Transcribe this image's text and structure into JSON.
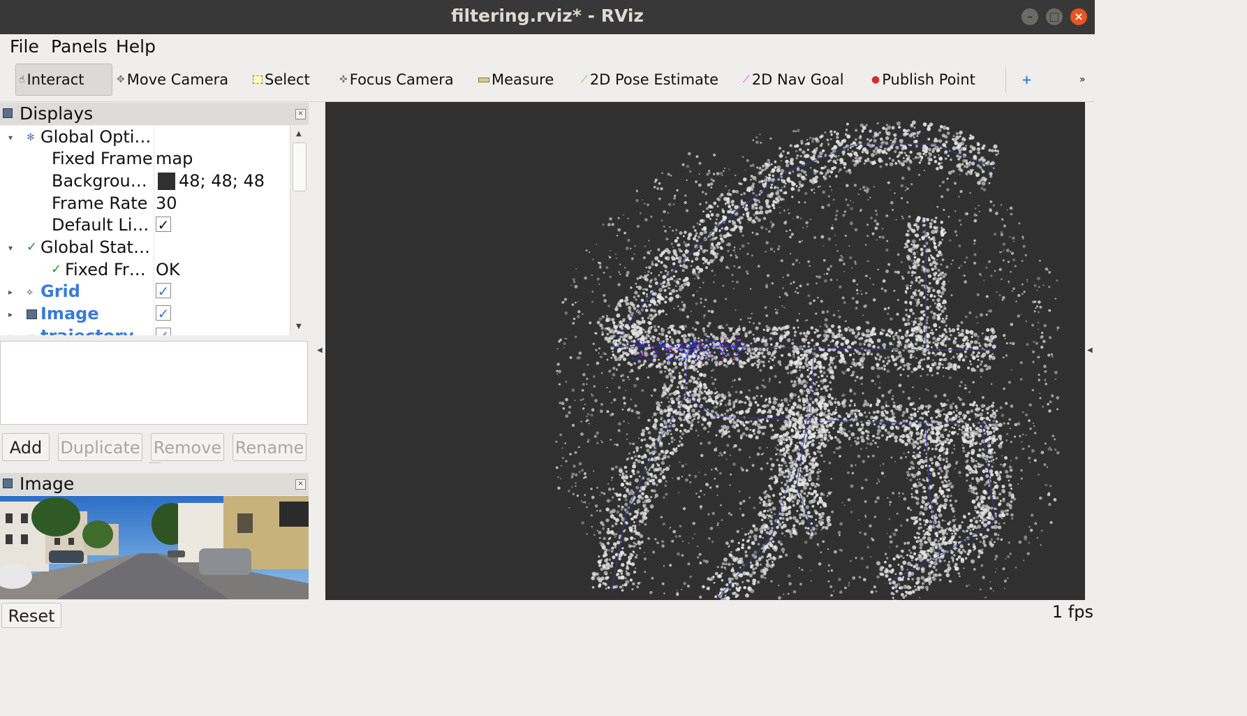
{
  "window": {
    "title": "filtering.rviz* - RViz"
  },
  "menu": {
    "file": "File",
    "panels": "Panels",
    "help": "Help"
  },
  "toolbar": {
    "interact": "Interact",
    "move_camera": "Move Camera",
    "select": "Select",
    "focus_camera": "Focus Camera",
    "measure": "Measure",
    "pose_estimate": "2D Pose Estimate",
    "nav_goal": "2D Nav Goal",
    "publish_point": "Publish Point",
    "add_tool": "+",
    "more": "»"
  },
  "displays_panel": {
    "title": "Displays",
    "rows": [
      {
        "name": "Global Opti…",
        "value": ""
      },
      {
        "name": "Fixed Frame",
        "value": "map"
      },
      {
        "name": "Backgrou…",
        "value": "48; 48; 48",
        "swatch": "#303030"
      },
      {
        "name": "Frame Rate",
        "value": "30"
      },
      {
        "name": "Default Li…",
        "value": "✓"
      },
      {
        "name": "Global Stat…",
        "value": ""
      },
      {
        "name": "Fixed Fr…",
        "value": "OK"
      },
      {
        "name": "Grid",
        "value": "✓"
      },
      {
        "name": "Image",
        "value": "✓"
      },
      {
        "name": "trajectory",
        "value": "✓"
      }
    ],
    "buttons": {
      "add": "Add",
      "duplicate": "Duplicate",
      "remove": "Remove",
      "rename": "Rename"
    }
  },
  "image_panel": {
    "title": "Image"
  },
  "status": {
    "reset": "Reset",
    "fps": "1 fps"
  },
  "colors": {
    "viewport_bg": "#303030",
    "link": "#3a7bd5",
    "window_bg": "#efeeec"
  }
}
